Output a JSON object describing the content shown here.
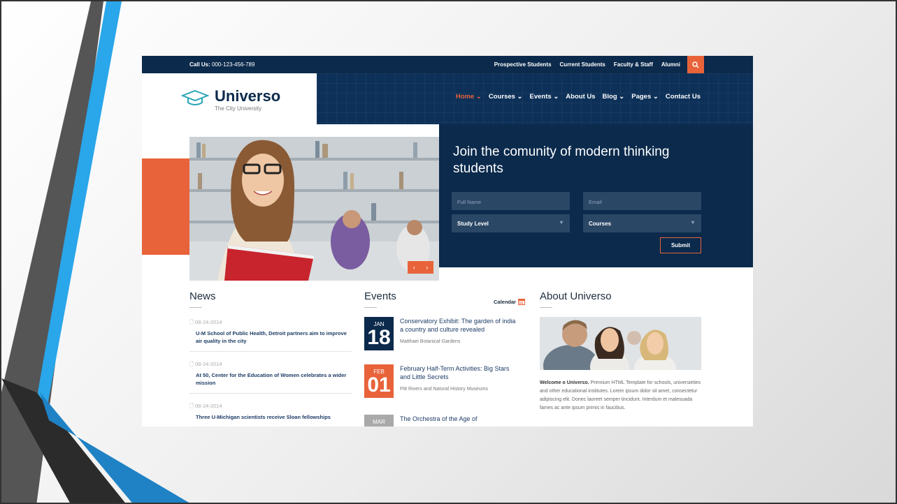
{
  "topbar": {
    "call_label": "Call Us:",
    "phone": "000-123-456-789",
    "links": [
      "Prospective Students",
      "Current Students",
      "Faculty & Staff",
      "Alumni"
    ]
  },
  "logo": {
    "name": "Universo",
    "tagline": "The City University"
  },
  "nav": {
    "items": [
      {
        "label": "Home",
        "has_dropdown": true,
        "active": true
      },
      {
        "label": "Courses",
        "has_dropdown": true
      },
      {
        "label": "Events",
        "has_dropdown": true
      },
      {
        "label": "About Us",
        "has_dropdown": false
      },
      {
        "label": "Blog",
        "has_dropdown": true
      },
      {
        "label": "Pages",
        "has_dropdown": true
      },
      {
        "label": "Contact Us",
        "has_dropdown": false
      }
    ]
  },
  "hero": {
    "title": "Join the comunity of modern thinking students",
    "form": {
      "name_placeholder": "Full Name",
      "email_placeholder": "Email",
      "study_level": "Study Level",
      "courses": "Courses",
      "submit": "Submit"
    }
  },
  "news": {
    "title": "News",
    "items": [
      {
        "date": "08-24-2014",
        "text": "U-M School of Public Health, Detroit partners aim to improve air quality in the city"
      },
      {
        "date": "08-24-2014",
        "text": "At 50, Center for the Education of Women celebrates a wider mission"
      },
      {
        "date": "08-24-2014",
        "text": "Three U-Michigan scientists receive Sloan fellowships"
      }
    ]
  },
  "events": {
    "title": "Events",
    "calendar_label": "Calendar",
    "items": [
      {
        "month": "JAN",
        "day": "18",
        "title": "Conservatory Exhibit: The garden of india a country and culture revealed",
        "location": "Matthaei Botanical Gardens"
      },
      {
        "month": "FEB",
        "day": "01",
        "title": "February Half-Term Activities: Big Stars and Little Secrets",
        "location": "Pitt Rivers and Natural History Museums"
      },
      {
        "month": "MAR",
        "day": "",
        "title": "The Orchestra of the Age of",
        "location": ""
      }
    ]
  },
  "about": {
    "title": "About Universo",
    "lead": "Welcome o Universo.",
    "text": "Premium HTML Template for schools, universieties and other educational institutes. Lorem ipsum dolor sit amet, consectetur adipiscing elit. Donec laoreet semper tincidunt. Interdum et malesuada fames ac ante ipsum primis in faucibus."
  },
  "colors": {
    "navy": "#0b2a4c",
    "orange": "#e8633a",
    "slide_blue": "#29a3e6"
  }
}
